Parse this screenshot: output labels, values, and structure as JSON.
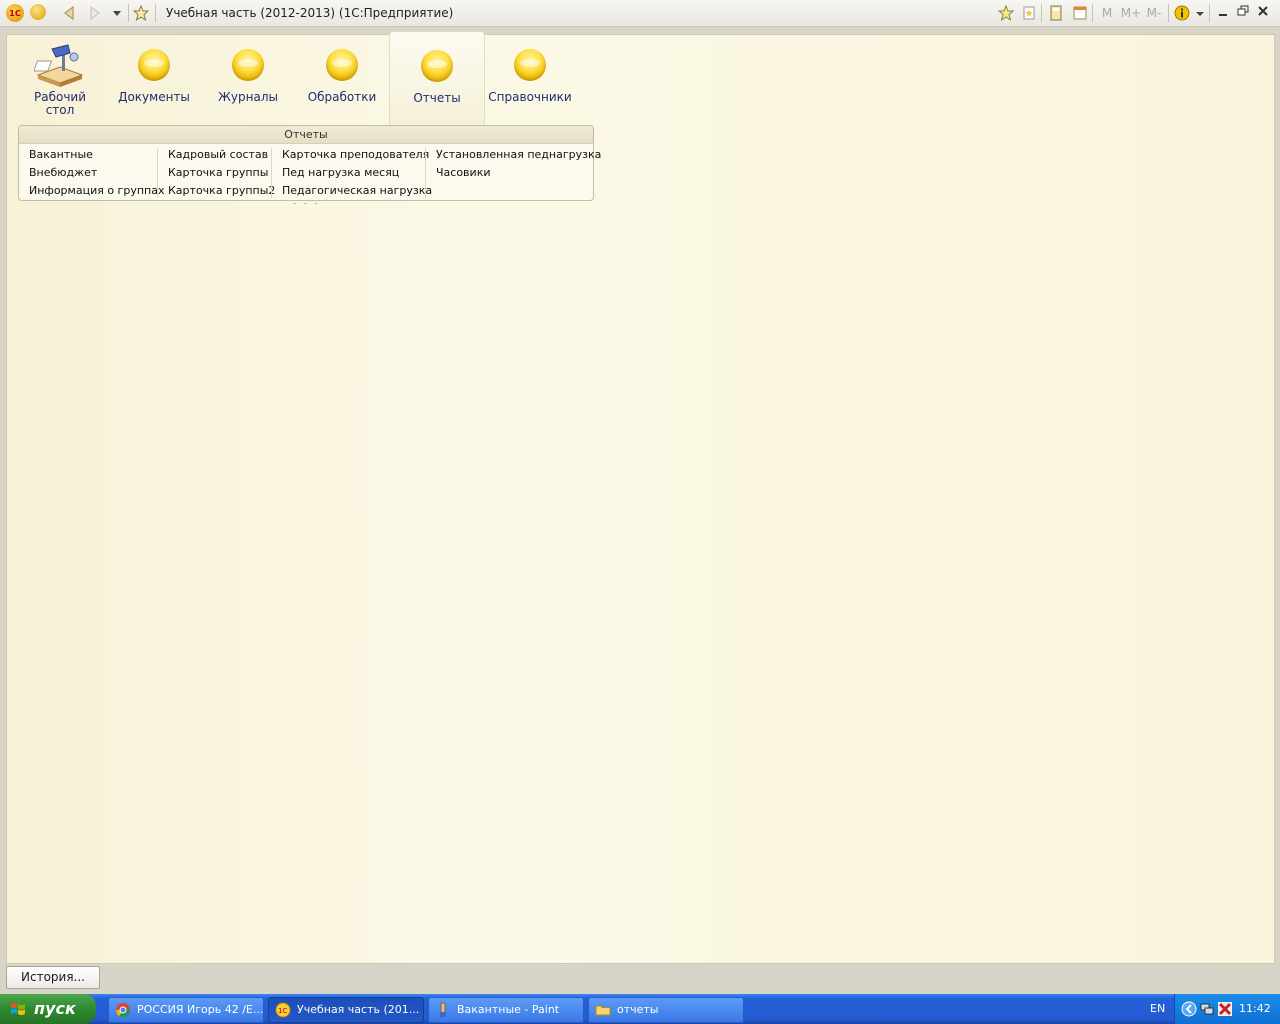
{
  "window": {
    "title": "Учебная часть (2012-2013)  (1С:Предприятие)"
  },
  "sections": [
    {
      "label": "Рабочий стол"
    },
    {
      "label": "Документы"
    },
    {
      "label": "Журналы"
    },
    {
      "label": "Обработки"
    },
    {
      "label": "Отчеты"
    },
    {
      "label": "Справочники"
    }
  ],
  "reports_panel": {
    "title": "Отчеты",
    "columns": [
      [
        "Вакантные",
        "Внебюджет",
        "Информация о группах"
      ],
      [
        "Кадровый состав",
        "Карточка группы",
        "Карточка группы2"
      ],
      [
        "Карточка преподователя",
        "Пед нагрузка месяц",
        "Педагогическая нагрузка"
      ],
      [
        "Установленная педнагрузка",
        "Часовики"
      ]
    ]
  },
  "history_button": "История...",
  "taskbar": {
    "start": "пуск",
    "tasks": [
      {
        "label": "РОССИЯ Игорь 42 /Е..."
      },
      {
        "label": "Учебная часть (201..."
      },
      {
        "label": "Вакантные - Paint"
      },
      {
        "label": "отчеты"
      }
    ],
    "lang": "EN",
    "time": "11:42"
  }
}
